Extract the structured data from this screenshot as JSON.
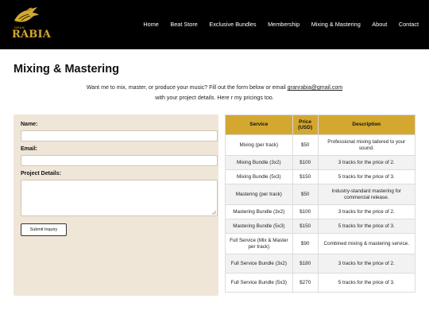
{
  "header": {
    "logo": {
      "small_text": "GRAN",
      "brand": "RABIA"
    },
    "nav": [
      "Home",
      "Beat Store",
      "Exclusive Bundles",
      "Membership",
      "Mixing & Mastering",
      "About",
      "Contact"
    ]
  },
  "page": {
    "title": "Mixing & Mastering",
    "intro_before": "Want me to mix, master, or produce your music? Fill out the form below or email ",
    "email": "granrabia@gmail.com",
    "intro_line2": "with your project details. Here r my pricings too."
  },
  "form": {
    "name_label": "Name:",
    "name_value": "",
    "email_label": "Email:",
    "email_value": "",
    "details_label": "Project Details:",
    "details_value": "",
    "submit_label": "Submit Inquiry"
  },
  "pricing": {
    "headers": {
      "service": "Service",
      "price": "Price\n(USD)",
      "description": "Description"
    },
    "rows": [
      {
        "service": "Mixing (per track)",
        "price": "$50",
        "description": "Professional mixing tailored to your sound."
      },
      {
        "service": "Mixing Bundle (3x2)",
        "price": "$100",
        "description": "3 tracks for the price of 2."
      },
      {
        "service": "Mixing Bundle (5x3)",
        "price": "$150",
        "description": "5 tracks for the price of 3."
      },
      {
        "service": "Mastering (per track)",
        "price": "$50",
        "description": "Industry-standard mastering for commercial release."
      },
      {
        "service": "Mastering Bundle (3x2)",
        "price": "$100",
        "description": "3 tracks for the price of 2."
      },
      {
        "service": "Mastering Bundle (5x3)",
        "price": "$150",
        "description": "5 tracks for the price of 3."
      },
      {
        "service": "Full Service (Mix & Master per track)",
        "price": "$90",
        "description": "Combined mixing & mastering service."
      },
      {
        "service": "Full Service Bundle (3x2)",
        "price": "$180",
        "description": "3 tracks for the price of 2."
      },
      {
        "service": "Full Service Bundle (5x3)",
        "price": "$270",
        "description": "5 tracks for the price of 3."
      }
    ]
  },
  "colors": {
    "header_bg": "#000000",
    "accent_gold": "#d4a830",
    "form_bg": "#efe6d8"
  },
  "icons": {
    "logo": "eagle-logo-icon",
    "textarea_resize": "resize-grip-icon"
  }
}
